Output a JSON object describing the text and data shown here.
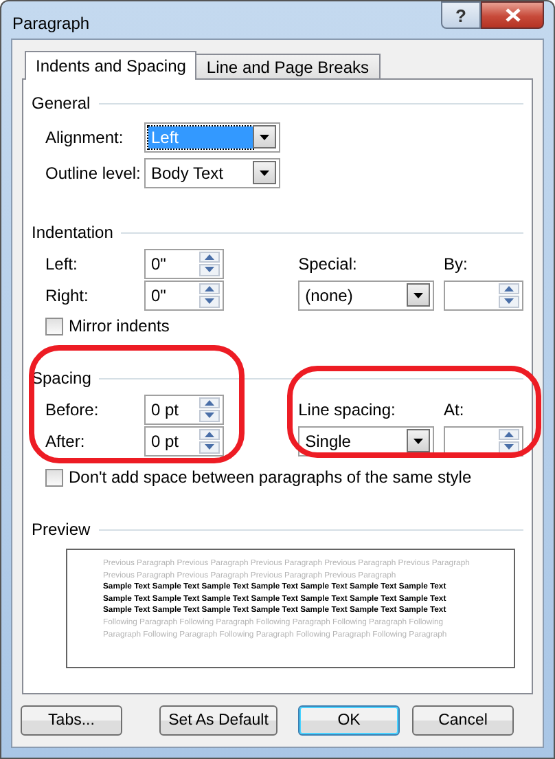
{
  "window": {
    "title": "Paragraph",
    "help": "?"
  },
  "tabs": [
    {
      "label": "Indents and Spacing",
      "selected": true
    },
    {
      "label": "Line and Page Breaks",
      "selected": false
    }
  ],
  "general": {
    "heading": "General",
    "alignment": {
      "label": "Alignment:",
      "value": "Left",
      "highlighted": true
    },
    "outline_level": {
      "label": "Outline level:",
      "value": "Body Text",
      "highlighted": false
    }
  },
  "indentation": {
    "heading": "Indentation",
    "left": {
      "label": "Left:",
      "value": "0\""
    },
    "right": {
      "label": "Right:",
      "value": "0\""
    },
    "special": {
      "label": "Special:",
      "value": "(none)"
    },
    "by": {
      "label": "By:"
    },
    "mirror_indents": {
      "label": "Mirror indents",
      "checked": false
    }
  },
  "spacing": {
    "heading": "Spacing",
    "circled_left": true,
    "circled_right": true,
    "before": {
      "label": "Before:",
      "value": "0 pt"
    },
    "after": {
      "label": "After:",
      "value": "0 pt"
    },
    "line_spacing": {
      "label": "Line spacing:",
      "value": "Single"
    },
    "at": {
      "label": "At:"
    },
    "dont_add_space": {
      "label": "Don't add space between paragraphs of the same style",
      "checked": false
    }
  },
  "preview": {
    "heading": "Preview",
    "previous": "Previous Paragraph Previous Paragraph Previous Paragraph Previous Paragraph Previous Paragraph Previous Paragraph Previous Paragraph Previous Paragraph Previous Paragraph",
    "sample": "Sample Text Sample Text Sample Text Sample Text Sample Text Sample Text Sample Text Sample Text Sample Text Sample Text Sample Text Sample Text Sample Text Sample Text Sample Text Sample Text Sample Text Sample Text Sample Text Sample Text Sample Text",
    "following": "Following Paragraph Following Paragraph Following Paragraph Following Paragraph Following Paragraph Following Paragraph Following Paragraph Following Paragraph Following Paragraph"
  },
  "buttons": [
    {
      "label": "Tabs...",
      "default": false
    },
    {
      "label": "Set As Default",
      "default": false
    },
    {
      "label": "OK",
      "default": true
    },
    {
      "label": "Cancel",
      "default": false
    }
  ]
}
